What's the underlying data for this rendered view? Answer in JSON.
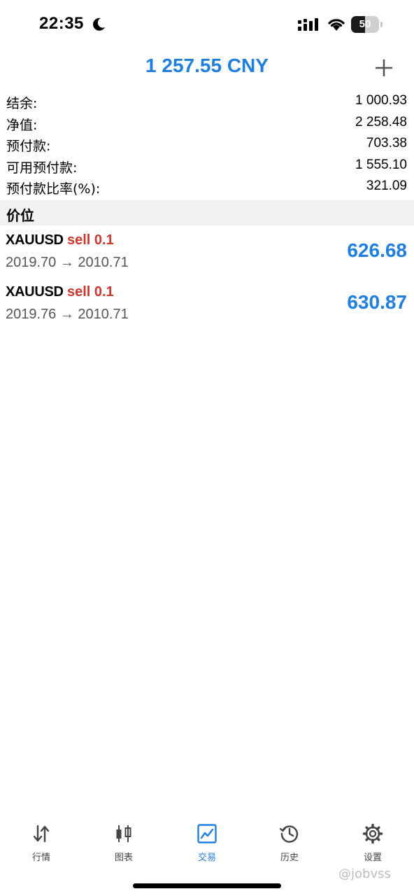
{
  "status_bar": {
    "time": "22:35",
    "battery": "50",
    "battery_level": 0.5
  },
  "header": {
    "title": "1 257.55 CNY",
    "add_icon": "plus-icon"
  },
  "summary": [
    {
      "label": "结余:",
      "value": "1 000.93"
    },
    {
      "label": "净值:",
      "value": "2 258.48"
    },
    {
      "label": "预付款:",
      "value": "703.38"
    },
    {
      "label": "可用预付款:",
      "value": "1 555.10"
    },
    {
      "label": "预付款比率(%):",
      "value": "321.09"
    }
  ],
  "section": {
    "title": "价位"
  },
  "positions": [
    {
      "symbol": "XAUUSD",
      "type": "sell 0.1",
      "prices": "2019.70 → 2010.71",
      "profit": "626.68"
    },
    {
      "symbol": "XAUUSD",
      "type": "sell 0.1",
      "prices": "2019.76 → 2010.71",
      "profit": "630.87"
    }
  ],
  "tabs": [
    {
      "label": "行情",
      "icon": "quotes-arrows-icon",
      "active": false
    },
    {
      "label": "图表",
      "icon": "candlestick-icon",
      "active": false
    },
    {
      "label": "交易",
      "icon": "trade-chart-icon",
      "active": true
    },
    {
      "label": "历史",
      "icon": "history-clock-icon",
      "active": false
    },
    {
      "label": "设置",
      "icon": "gear-icon",
      "active": false
    }
  ],
  "watermark": "@jobvss",
  "colors": {
    "accent": "#1e7fe0",
    "sell": "#d0362b",
    "tab_inactive": "#444444"
  }
}
